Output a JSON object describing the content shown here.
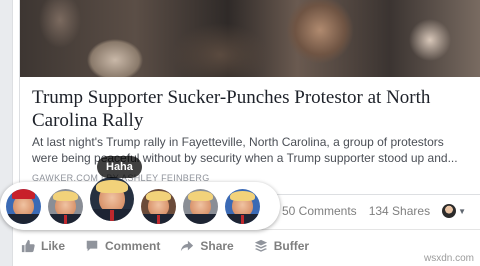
{
  "article": {
    "title": "Trump Supporter Sucker-Punches Protestor at North Carolina Rally",
    "description": "At last night's Trump rally in Fayetteville, North Carolina, a group of protestors were being peaceful without by security when a Trump supporter stood up and...",
    "source": "GAWKER.COM | BY ASHLEY FEINBERG"
  },
  "counts": {
    "comments": "50 Comments",
    "shares": "134 Shares"
  },
  "actions": {
    "like": "Like",
    "comment": "Comment",
    "share": "Share",
    "buffer": "Buffer"
  },
  "reactions": {
    "tooltip": "Haha",
    "items": [
      {
        "name": "like"
      },
      {
        "name": "love"
      },
      {
        "name": "haha"
      },
      {
        "name": "wow"
      },
      {
        "name": "sad"
      },
      {
        "name": "angry"
      }
    ]
  },
  "watermark": "wsxdn.com"
}
